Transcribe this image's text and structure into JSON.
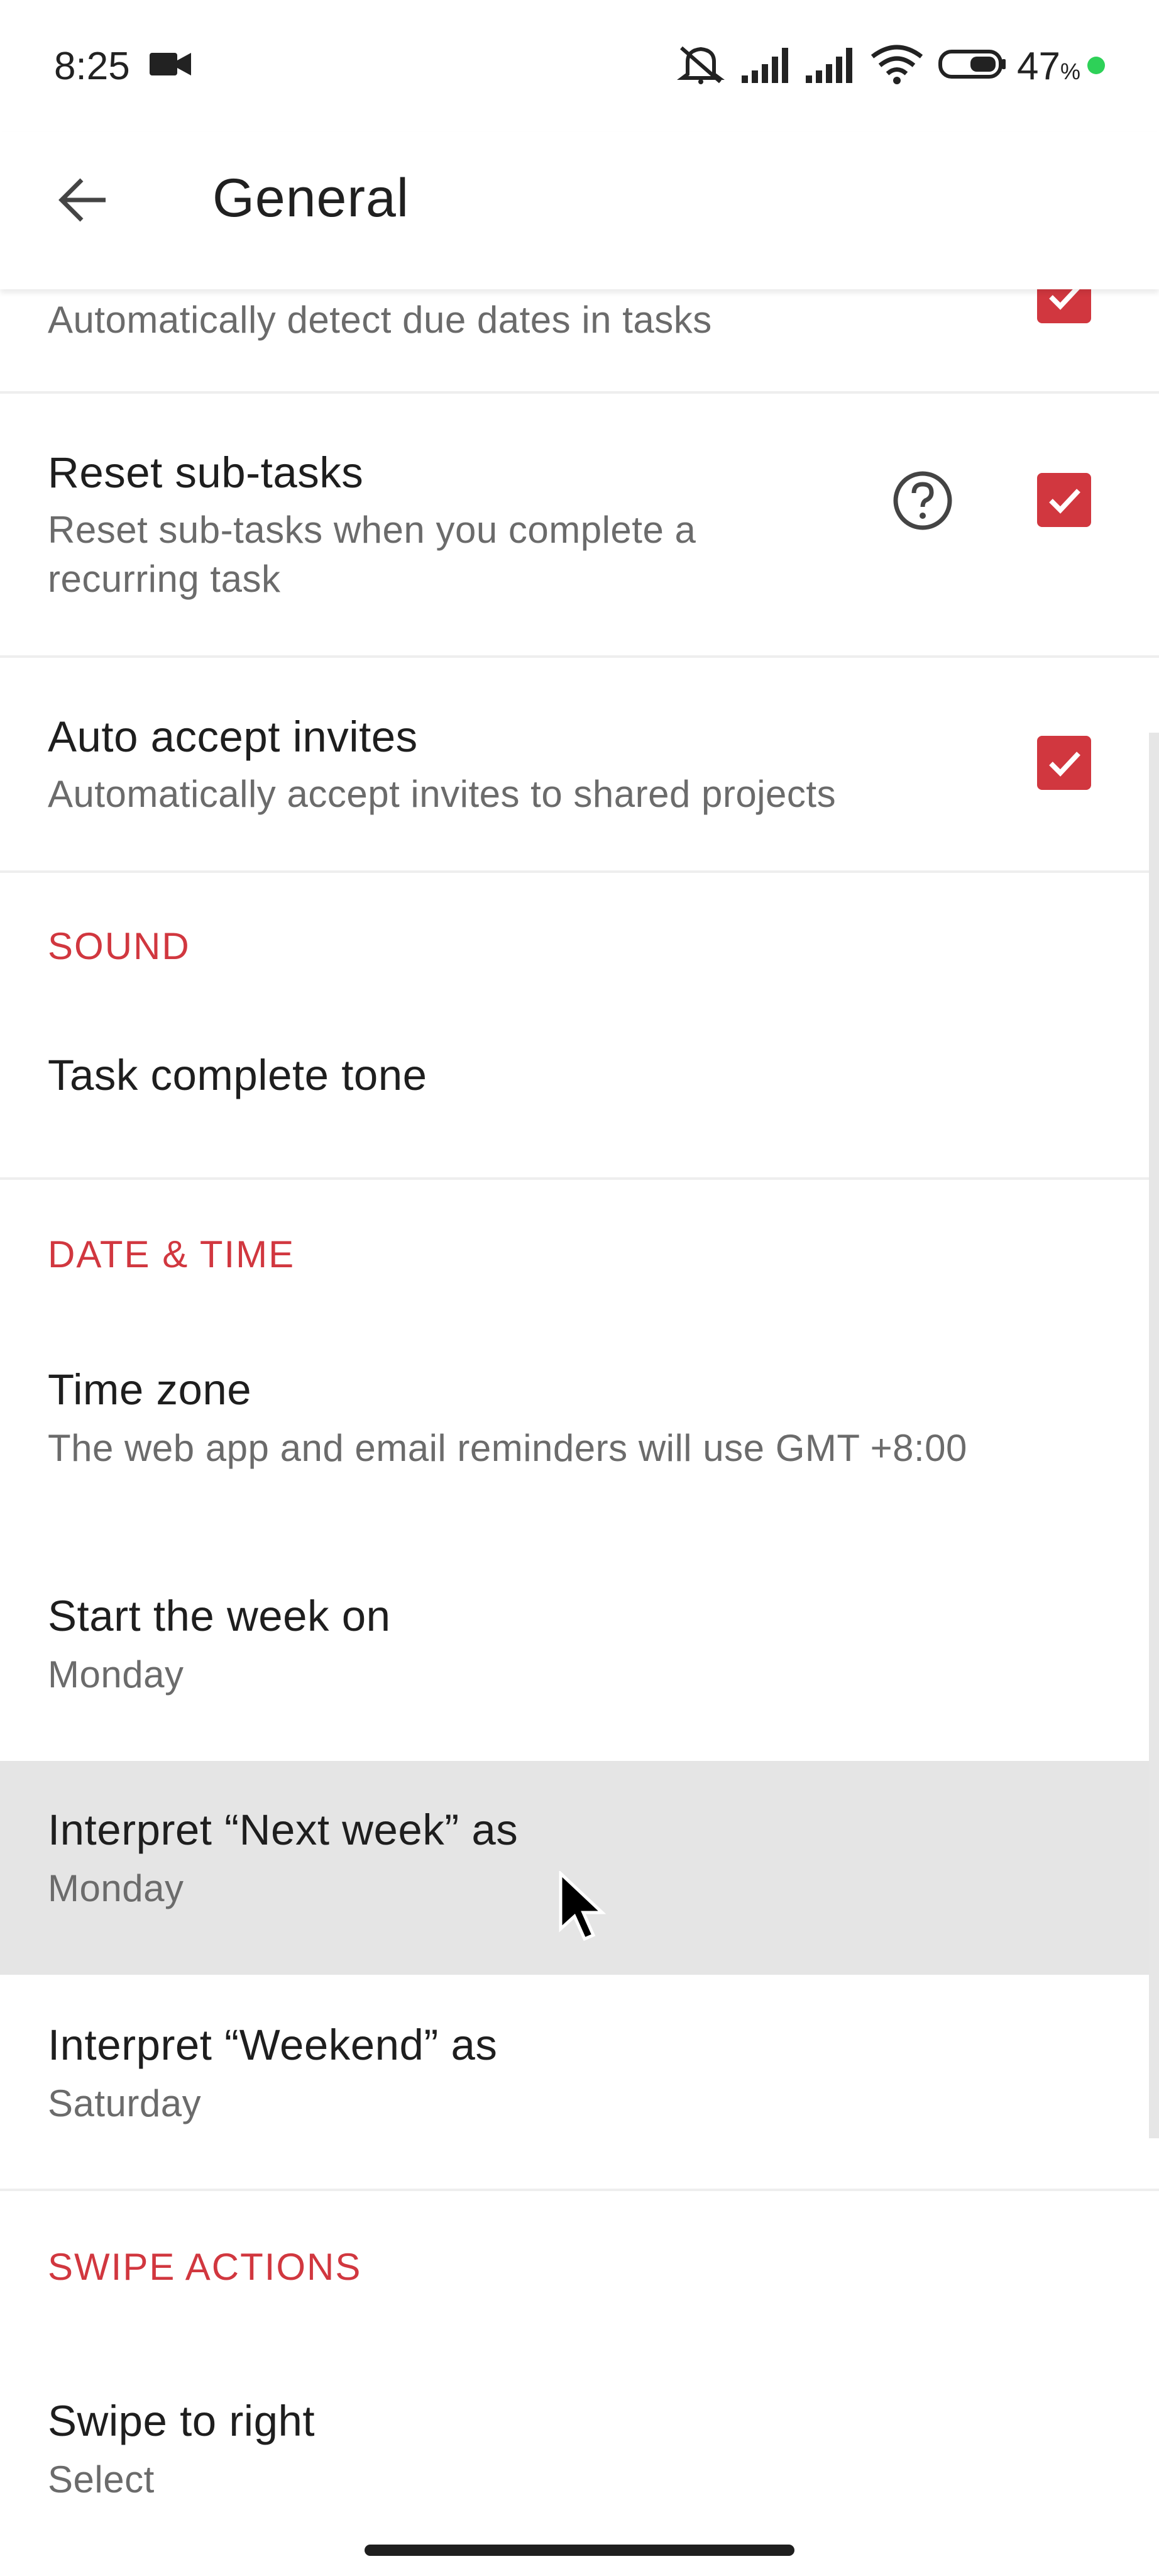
{
  "status_bar": {
    "time": "8:25",
    "battery_percent": "47",
    "battery_symbol": "%",
    "icons": [
      "video-camera-icon",
      "mute-icon",
      "signal-icon",
      "signal-icon",
      "wifi-icon",
      "battery-icon"
    ]
  },
  "app_bar": {
    "title": "General",
    "back_icon": "back-arrow-icon"
  },
  "settings": {
    "smart_date": {
      "subtitle": "Automatically detect due dates in tasks",
      "checked": true
    },
    "reset_subtasks": {
      "title": "Reset sub-tasks",
      "subtitle_line1": "Reset sub-tasks when you complete a",
      "subtitle_line2": "recurring task",
      "checked": true
    },
    "auto_accept": {
      "title": "Auto accept invites",
      "subtitle": "Automatically accept invites to shared projects",
      "checked": true
    }
  },
  "sections": {
    "sound": "SOUND",
    "date_time": "DATE & TIME",
    "swipe": "SWIPE ACTIONS"
  },
  "sound": {
    "task_tone": {
      "title": "Task complete tone"
    }
  },
  "date_time": {
    "time_zone": {
      "title": "Time zone",
      "subtitle": "The web app and email reminders will use GMT +8:00"
    },
    "start_week": {
      "title": "Start the week on",
      "value": "Monday"
    },
    "next_week": {
      "title": "Interpret “Next week” as",
      "value": "Monday"
    },
    "weekend": {
      "title": "Interpret “Weekend” as",
      "value": "Saturday"
    }
  },
  "swipe": {
    "swipe_right": {
      "title": "Swipe to right",
      "value": "Select"
    }
  },
  "colors": {
    "accent": "#d1373f",
    "highlight": "#e5e5e5",
    "subtitle": "#6b6b6b"
  }
}
